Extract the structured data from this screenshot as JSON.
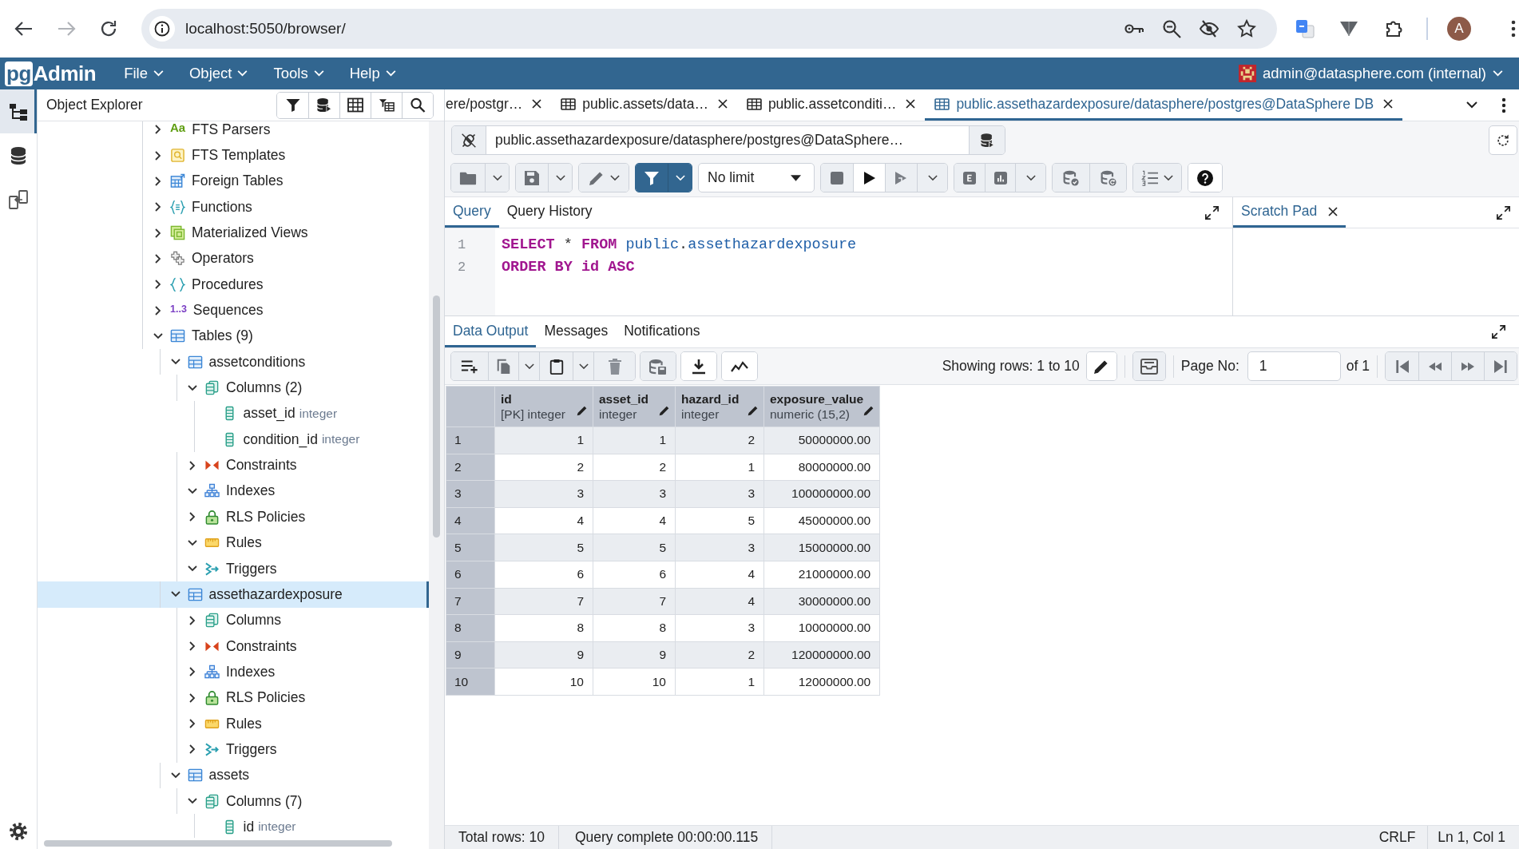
{
  "browser": {
    "nav": [
      {
        "kind": "back",
        "disabled": false
      },
      {
        "kind": "forward",
        "disabled": true
      },
      {
        "kind": "reload",
        "disabled": false
      }
    ],
    "url": "localhost:5050/browser/",
    "avatar": "A"
  },
  "app_bar": {
    "logo_box": "pg",
    "logo_text": "Admin",
    "menus": [
      {
        "label": "File"
      },
      {
        "label": "Object"
      },
      {
        "label": "Tools"
      },
      {
        "label": "Help"
      }
    ],
    "user": "admin@datasphere.com (internal)"
  },
  "rail": [
    {
      "kind": "tree",
      "selected": true
    },
    {
      "kind": "database",
      "selected": false
    },
    {
      "kind": "compare",
      "selected": false
    }
  ],
  "object_explorer": {
    "title": "Object Explorer",
    "tree": [
      {
        "label": "FTS Parsers",
        "kind": "fts_parser",
        "badge": "Aa",
        "expanded": false,
        "selected": false
      },
      {
        "label": "FTS Templates",
        "kind": "fts_template",
        "expanded": false,
        "selected": false
      },
      {
        "label": "Foreign Tables",
        "kind": "foreign_table",
        "expanded": false,
        "selected": false
      },
      {
        "label": "Functions",
        "kind": "function",
        "expanded": false,
        "selected": false
      },
      {
        "label": "Materialized Views",
        "kind": "materialized_view",
        "expanded": false,
        "selected": false
      },
      {
        "label": "Operators",
        "kind": "operator",
        "expanded": false,
        "selected": false
      },
      {
        "label": "Procedures",
        "kind": "procedure",
        "expanded": false,
        "selected": false
      },
      {
        "label": "Sequences",
        "kind": "sequence",
        "badge": "1..3",
        "expanded": false,
        "selected": false
      },
      {
        "label": "Tables (9)",
        "kind": "table",
        "expanded": true,
        "selected": false,
        "children": [
          {
            "label": "assetconditions",
            "kind": "table",
            "expanded": true,
            "selected": false,
            "children": [
              {
                "label": "Columns (2)",
                "kind": "columns",
                "expanded": true,
                "selected": false,
                "children": [
                  {
                    "label": "asset_id",
                    "type": "integer",
                    "kind": "column",
                    "selected": false
                  },
                  {
                    "label": "condition_id",
                    "type": "integer",
                    "kind": "column",
                    "selected": false
                  }
                ]
              },
              {
                "label": "Constraints",
                "kind": "constraints",
                "expanded": false,
                "selected": false
              },
              {
                "label": "Indexes",
                "kind": "indexes",
                "expanded": true,
                "selected": false
              },
              {
                "label": "RLS Policies",
                "kind": "rls_policies",
                "expanded": false,
                "selected": false
              },
              {
                "label": "Rules",
                "kind": "rules",
                "expanded": true,
                "selected": false
              },
              {
                "label": "Triggers",
                "kind": "triggers",
                "expanded": true,
                "selected": false
              }
            ]
          },
          {
            "label": "assethazardexposure",
            "kind": "table",
            "expanded": true,
            "selected": true,
            "children": [
              {
                "label": "Columns",
                "kind": "columns",
                "expanded": false,
                "selected": false
              },
              {
                "label": "Constraints",
                "kind": "constraints",
                "expanded": false,
                "selected": false
              },
              {
                "label": "Indexes",
                "kind": "indexes",
                "expanded": false,
                "selected": false
              },
              {
                "label": "RLS Policies",
                "kind": "rls_policies",
                "expanded": false,
                "selected": false
              },
              {
                "label": "Rules",
                "kind": "rules",
                "expanded": false,
                "selected": false
              },
              {
                "label": "Triggers",
                "kind": "triggers",
                "expanded": false,
                "selected": false
              }
            ]
          },
          {
            "label": "assets",
            "kind": "table",
            "expanded": true,
            "selected": false,
            "children": [
              {
                "label": "Columns (7)",
                "kind": "columns",
                "expanded": true,
                "selected": false,
                "children": [
                  {
                    "label": "id",
                    "type": "integer",
                    "kind": "column",
                    "selected": false
                  }
                ]
              }
            ]
          }
        ]
      }
    ]
  },
  "editor_tabs": [
    {
      "label": "ere/postgr…",
      "kind": "cut",
      "selected": false
    },
    {
      "label": "public.assets/data…",
      "kind": "table",
      "selected": false
    },
    {
      "label": "public.assetconditi…",
      "kind": "table",
      "selected": false
    },
    {
      "label": "public.assethazardexposure/datasphere/postgres@DataSphere DB",
      "kind": "table",
      "selected": true
    }
  ],
  "connection": {
    "value": "public.assethazardexposure/datasphere/postgres@DataSphere…"
  },
  "query_toolbar": {
    "row_limit": "No limit"
  },
  "query_tabs": [
    {
      "label": "Query",
      "selected": true
    },
    {
      "label": "Query History",
      "selected": false
    }
  ],
  "query_lines": [
    {
      "number": "1",
      "tokens": [
        {
          "kind": "keyword",
          "text": "SELECT"
        },
        {
          "kind": "plain",
          "text": " * "
        },
        {
          "kind": "keyword",
          "text": "FROM"
        },
        {
          "kind": "name",
          "text": " public"
        },
        {
          "kind": "plain",
          "text": "."
        },
        {
          "kind": "name",
          "text": "assethazardexposure"
        }
      ]
    },
    {
      "number": "2",
      "tokens": [
        {
          "kind": "keyword",
          "text": "ORDER BY id ASC"
        }
      ]
    }
  ],
  "scratch_pad": {
    "label": "Scratch Pad",
    "selected": true
  },
  "output_tabs": [
    {
      "label": "Data Output",
      "selected": true
    },
    {
      "label": "Messages",
      "selected": false
    },
    {
      "label": "Notifications",
      "selected": false
    }
  ],
  "grid_toolbar": {
    "showing": "Showing rows: 1 to 10",
    "page_label": "Page No:",
    "page": "1",
    "page_total": "of 1"
  },
  "table": {
    "columns": [
      {
        "name": "id",
        "type": "[PK] integer"
      },
      {
        "name": "asset_id",
        "type": "integer"
      },
      {
        "name": "hazard_id",
        "type": "integer"
      },
      {
        "name": "exposure_value",
        "type": "numeric (15,2)"
      }
    ],
    "rows": [
      {
        "number": "1",
        "cells": [
          "1",
          "1",
          "2",
          "50000000.00"
        ]
      },
      {
        "number": "2",
        "cells": [
          "2",
          "2",
          "1",
          "80000000.00"
        ]
      },
      {
        "number": "3",
        "cells": [
          "3",
          "3",
          "3",
          "100000000.00"
        ]
      },
      {
        "number": "4",
        "cells": [
          "4",
          "4",
          "5",
          "45000000.00"
        ]
      },
      {
        "number": "5",
        "cells": [
          "5",
          "5",
          "3",
          "15000000.00"
        ]
      },
      {
        "number": "6",
        "cells": [
          "6",
          "6",
          "4",
          "21000000.00"
        ]
      },
      {
        "number": "7",
        "cells": [
          "7",
          "7",
          "4",
          "30000000.00"
        ]
      },
      {
        "number": "8",
        "cells": [
          "8",
          "8",
          "3",
          "10000000.00"
        ]
      },
      {
        "number": "9",
        "cells": [
          "9",
          "9",
          "2",
          "120000000.00"
        ]
      },
      {
        "number": "10",
        "cells": [
          "10",
          "10",
          "1",
          "12000000.00"
        ]
      }
    ]
  },
  "status_bar": {
    "total_rows": "Total rows: 10",
    "query_status": "Query complete 00:00:00.115",
    "line_ending": "CRLF",
    "cursor": "Ln 1, Col 1"
  }
}
